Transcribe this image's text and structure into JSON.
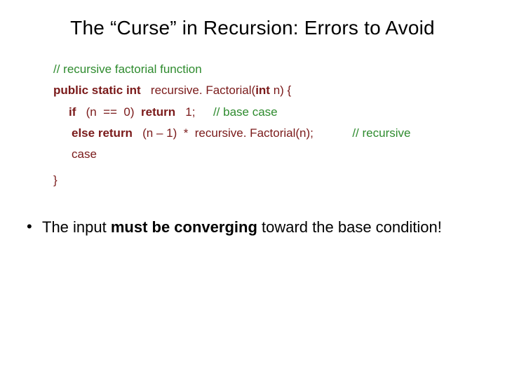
{
  "title": "The “Curse” in Recursion: Errors to Avoid",
  "code": {
    "comment1": "// recursive factorial function",
    "sig": {
      "kw_public": "public",
      "kw_static": "static",
      "kw_int": "int",
      "sp1": "  ",
      "fn_name": "recursive. Factorial(",
      "kw_int2": "int",
      "param_tail": " n) {"
    },
    "l_if": {
      "kw_if": "if",
      "cond": "  (n  ==  0)  ",
      "kw_return": "return",
      "ret_val": "  1; ",
      "comment": "// base case"
    },
    "l_else": {
      "kw_else": "else",
      "sp": " ",
      "kw_return": "return",
      "expr": "  (n – 1)  *  recursive. Factorial(n); ",
      "comment": "// recursive"
    },
    "l_case": "case",
    "closebrace": "}"
  },
  "bullet": {
    "dot": "•",
    "pre": "The input ",
    "strong": "must be converging",
    "post": " toward the base condition!"
  }
}
